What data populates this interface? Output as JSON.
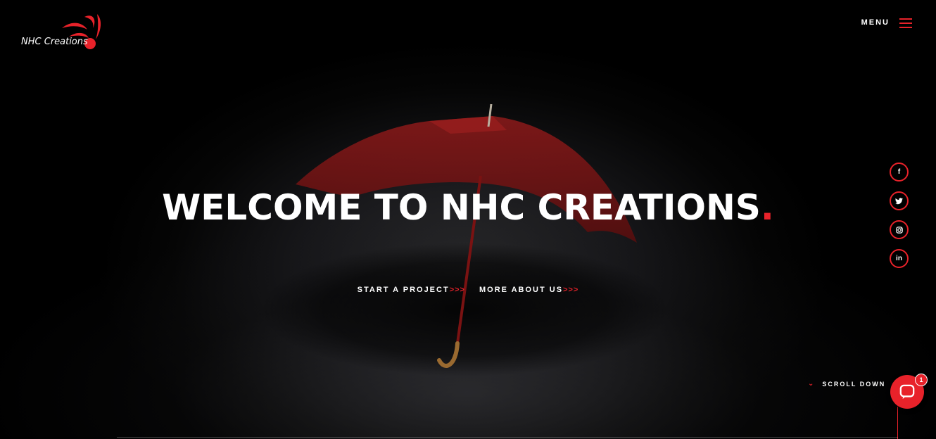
{
  "brand": {
    "name": "NHC Creations",
    "accent": "#e8222a"
  },
  "header": {
    "menu_label": "MENU"
  },
  "hero": {
    "title": "WELCOME TO NHC CREATIONS",
    "title_dot": ".",
    "ctas": [
      {
        "label": "START A PROJECT",
        "arrows": ">>>"
      },
      {
        "label": "MORE ABOUT US",
        "arrows": ">>>"
      }
    ]
  },
  "social": [
    {
      "icon": "facebook-icon",
      "glyph": "f"
    },
    {
      "icon": "twitter-icon",
      "glyph": "t"
    },
    {
      "icon": "instagram-icon",
      "glyph": "◎"
    },
    {
      "icon": "linkedin-icon",
      "glyph": "in"
    }
  ],
  "scroll": {
    "label": "SCROLL DOWN"
  },
  "chat": {
    "badge": "1"
  }
}
